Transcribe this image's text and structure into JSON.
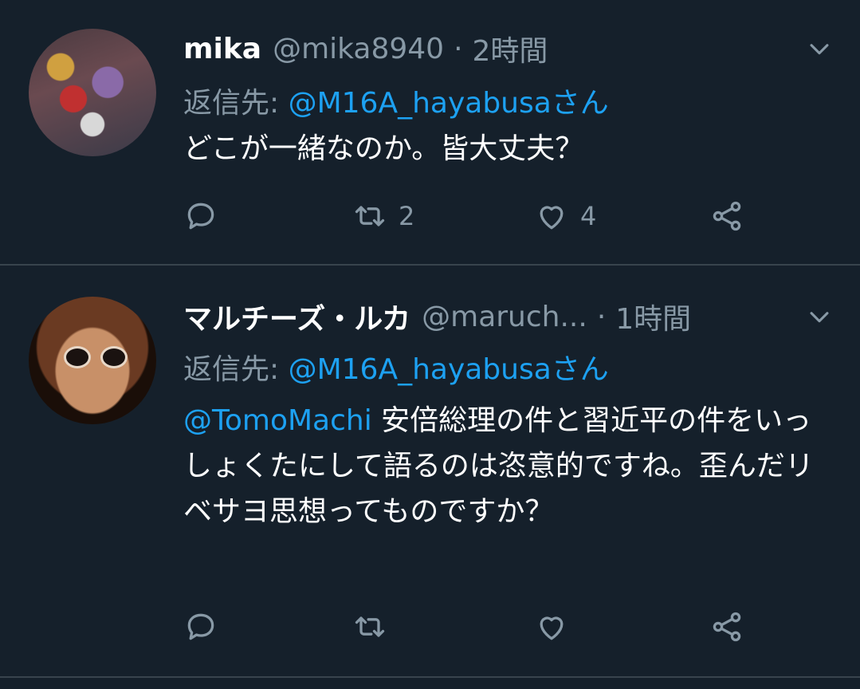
{
  "tweets": [
    {
      "name": "mika",
      "handle": "@mika8940",
      "separator": "·",
      "time": "2時間",
      "reply_prefix": "返信先: ",
      "reply_to": "@M16A_hayabusaさん",
      "body_mention": "",
      "body_text": "どこが一緒なのか。皆大丈夫？",
      "reply_count": "",
      "retweet_count": "2",
      "like_count": "4"
    },
    {
      "name": "マルチーズ・ルカ",
      "handle": "@maruch...",
      "separator": "·",
      "time": "1時間",
      "reply_prefix": "返信先: ",
      "reply_to": "@M16A_hayabusaさん",
      "body_mention": "@TomoMachi",
      "body_text": " 安倍総理の件と習近平の件をいっしょくたにして語るのは恣意的ですね。歪んだリベサヨ思想ってものですか？",
      "reply_count": "",
      "retweet_count": "",
      "like_count": ""
    }
  ],
  "colors": {
    "background": "#15202b",
    "divider": "#38444d",
    "secondary_text": "#8899a6",
    "link": "#1da1f2"
  },
  "icons": [
    "chevron-down-icon",
    "reply-icon",
    "retweet-icon",
    "like-icon",
    "share-icon"
  ]
}
